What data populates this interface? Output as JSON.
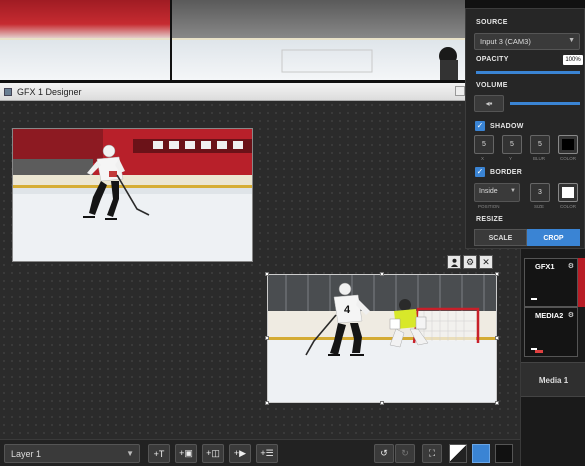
{
  "window": {
    "title": "GFX 1 Designer"
  },
  "source_panel": {
    "source_label": "SOURCE",
    "source_value": "Input 3 (CAM3)",
    "opacity_label": "OPACITY",
    "opacity_value": "100%",
    "opacity_fraction": 1.0,
    "volume_label": "VOLUME",
    "volume_fraction": 1.0,
    "shadow_label": "SHADOW",
    "shadow_checked": true,
    "shadow_x": "5",
    "shadow_y": "5",
    "shadow_blur": "5",
    "shadow_sub": {
      "x": "X",
      "y": "Y",
      "blur": "BLUR",
      "color": "COLOR"
    },
    "shadow_color": "#000000",
    "border_label": "BORDER",
    "border_checked": true,
    "border_position": "Inside",
    "border_size": "3",
    "border_sub": {
      "position": "POSITION",
      "size": "SIZE",
      "color": "COLOR"
    },
    "border_color": "#ffffff",
    "resize_label": "RESIZE",
    "scale_label": "SCALE",
    "crop_label": "CROP",
    "resize_selected": "CROP",
    "accent_color": "#3a84d4"
  },
  "toolbar": {
    "layer_value": "Layer 1",
    "add_text_label": "+T",
    "add_image_label": "+▣",
    "add_video_label": "+◫",
    "add_camera_label": "+▶",
    "add_list_label": "+☰",
    "undo_label": "↺",
    "redo_label": "↻",
    "fit_label": "⛶"
  },
  "right_column": {
    "gfx1_label": "GFX1",
    "media2_label": "MEDIA2",
    "media1_label": "Media 1"
  },
  "icons": {
    "user": "user-icon",
    "gear": "gear-icon",
    "close": "close-icon",
    "volume": "speaker-icon"
  }
}
